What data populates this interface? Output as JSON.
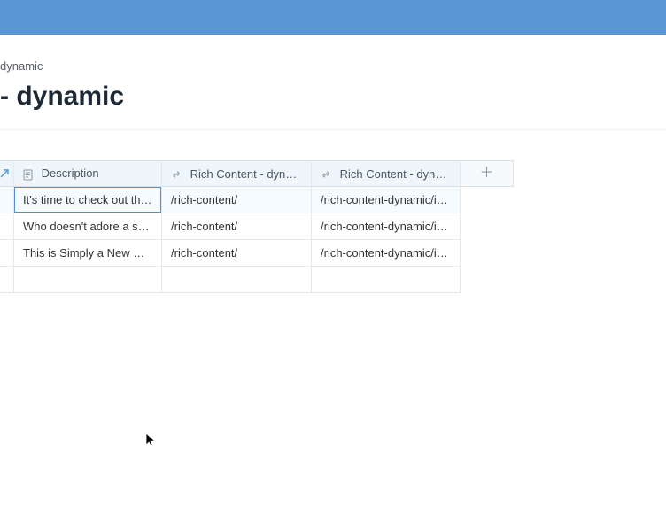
{
  "breadcrumb": "dynamic",
  "page_title": "- dynamic",
  "columns": {
    "description": "Description",
    "rich1": "Rich Content - dynam…",
    "rich2": "Rich Content - dynam…"
  },
  "rows": [
    {
      "description": "It's time to check out the …",
      "rich1": "/rich-content/",
      "rich2": "/rich-content-dynamic/i-a…"
    },
    {
      "description": "Who doesn't adore a smili…",
      "rich1": "/rich-content/",
      "rich2": "/rich-content-dynamic/i-a…"
    },
    {
      "description": "This is Simply a New Rich …",
      "rich1": "/rich-content/",
      "rich2": "/rich-content-dynamic/i-a…"
    }
  ]
}
